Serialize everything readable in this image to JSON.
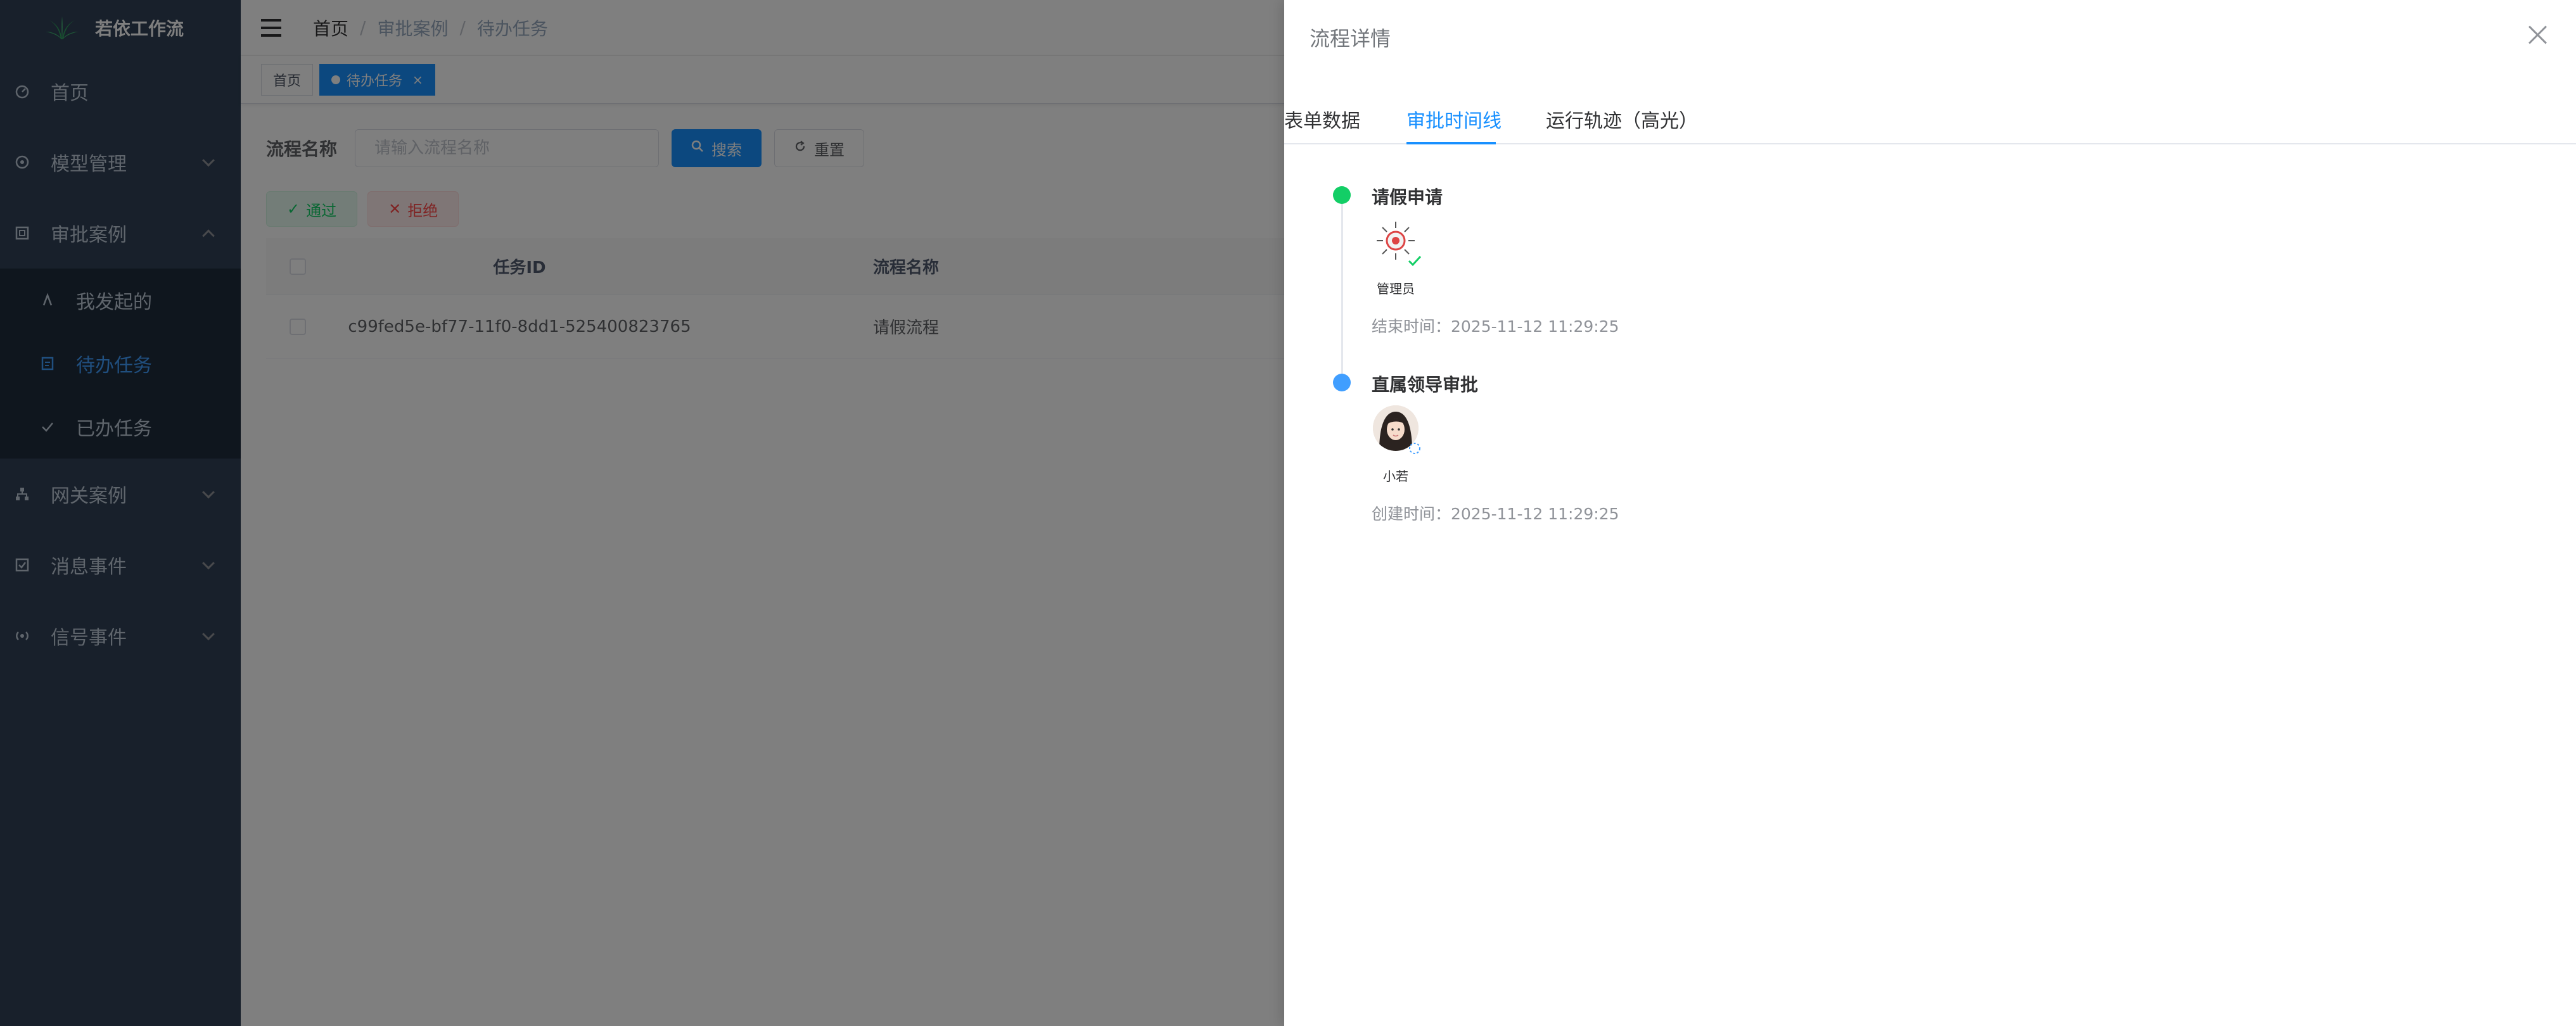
{
  "app": {
    "title": "若依工作流"
  },
  "sidebar": {
    "items": [
      {
        "label": "首页",
        "icon": "dashboard-icon"
      },
      {
        "label": "模型管理",
        "icon": "model-icon"
      },
      {
        "label": "审批案例",
        "icon": "approval-icon",
        "expanded": true,
        "children": [
          {
            "label": "我发起的",
            "icon": "initiated-icon"
          },
          {
            "label": "待办任务",
            "icon": "todo-icon",
            "active": true
          },
          {
            "label": "已办任务",
            "icon": "done-icon"
          }
        ]
      },
      {
        "label": "网关案例",
        "icon": "gateway-icon"
      },
      {
        "label": "消息事件",
        "icon": "message-icon"
      },
      {
        "label": "信号事件",
        "icon": "signal-icon"
      }
    ]
  },
  "breadcrumb": [
    "首页",
    "审批案例",
    "待办任务"
  ],
  "tags": [
    {
      "label": "首页"
    },
    {
      "label": "待办任务",
      "active": true,
      "close": "×"
    }
  ],
  "search": {
    "label": "流程名称",
    "placeholder": "请输入流程名称",
    "search_btn": "搜索",
    "reset_btn": "重置"
  },
  "actions": {
    "approve": "通过",
    "reject": "拒绝"
  },
  "table": {
    "columns": [
      "任务ID",
      "流程名称"
    ],
    "rows": [
      {
        "task_id": "c99fed5e-bf77-11f0-8dd1-525400823765",
        "process_name": "请假流程"
      }
    ]
  },
  "drawer": {
    "title": "流程详情",
    "tabs": [
      "表单数据",
      "审批时间线",
      "运行轨迹（高光）"
    ],
    "active_tab": "审批时间线",
    "timeline": [
      {
        "title": "请假申请",
        "user": "管理员",
        "time": "结束时间：2025-11-12 11:29:25",
        "status": "completed",
        "color": "#13ce66"
      },
      {
        "title": "直属领导审批",
        "user": "小若",
        "time": "创建时间：2025-11-12 11:29:25",
        "status": "pending",
        "color": "#409eff"
      }
    ]
  },
  "colors": {
    "primary": "#1890ff",
    "sidebar_bg": "#304156",
    "success": "#13ce66",
    "danger": "#ff4949"
  }
}
